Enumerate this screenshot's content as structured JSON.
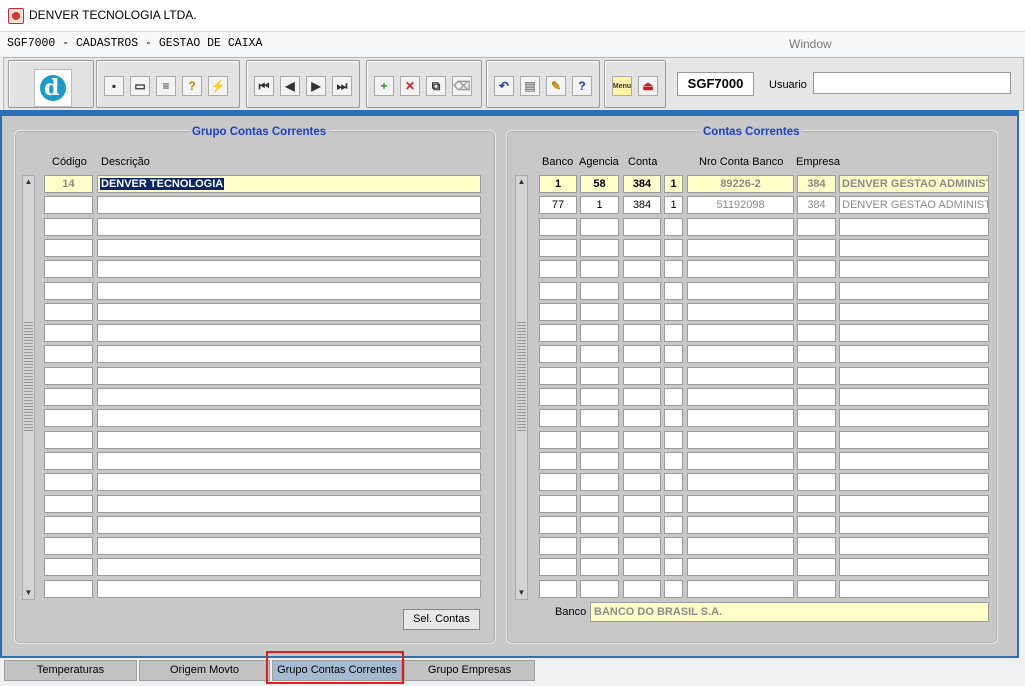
{
  "window": {
    "title": "DENVER TECNOLOGIA LTDA."
  },
  "menubar": {
    "form_title": "SGF7000 - CADASTROS - GESTAO DE CAIXA",
    "window_menu": "Window"
  },
  "toolbar": {
    "logo_letter": "d",
    "form_code": "SGF7000",
    "usuario_label": "Usuario",
    "usuario_value": "",
    "menu_button_label": "Menu",
    "help_label": "?"
  },
  "left_panel": {
    "title": "Grupo Contas Correntes",
    "headers": {
      "codigo": "Código",
      "descricao": "Descrição"
    },
    "rows": [
      {
        "codigo": "14",
        "descricao": "DENVER TECNOLOGIA"
      }
    ],
    "button_label": "Sel. Contas"
  },
  "right_panel": {
    "title": "Contas Correntes",
    "headers": {
      "banco": "Banco",
      "agencia": "Agencia",
      "conta": "Conta",
      "nro_conta": "Nro Conta Banco",
      "empresa": "Empresa"
    },
    "rows": [
      {
        "banco": "1",
        "agencia": "58",
        "conta": "384",
        "flag": "1",
        "nro_conta": "89226-2",
        "empresa": "384",
        "empresa_nome": "DENVER GESTAO ADMINISTRA"
      },
      {
        "banco": "77",
        "agencia": "1",
        "conta": "384",
        "flag": "1",
        "nro_conta": "51192098",
        "empresa": "384",
        "empresa_nome": "DENVER GESTAO ADMINISTRA"
      }
    ],
    "banco_label": "Banco",
    "banco_nome": "BANCO DO BRASIL S.A."
  },
  "tabs": [
    {
      "label": "Temperaturas"
    },
    {
      "label": "Origem Movto"
    },
    {
      "label": "Grupo Contas Correntes"
    },
    {
      "label": "Grupo Empresas"
    }
  ],
  "colors": {
    "accent": "#1d3fc6",
    "frame": "#2b6fb6",
    "field_yellow": "#ffffc8",
    "highlight": "#e31c1c"
  }
}
